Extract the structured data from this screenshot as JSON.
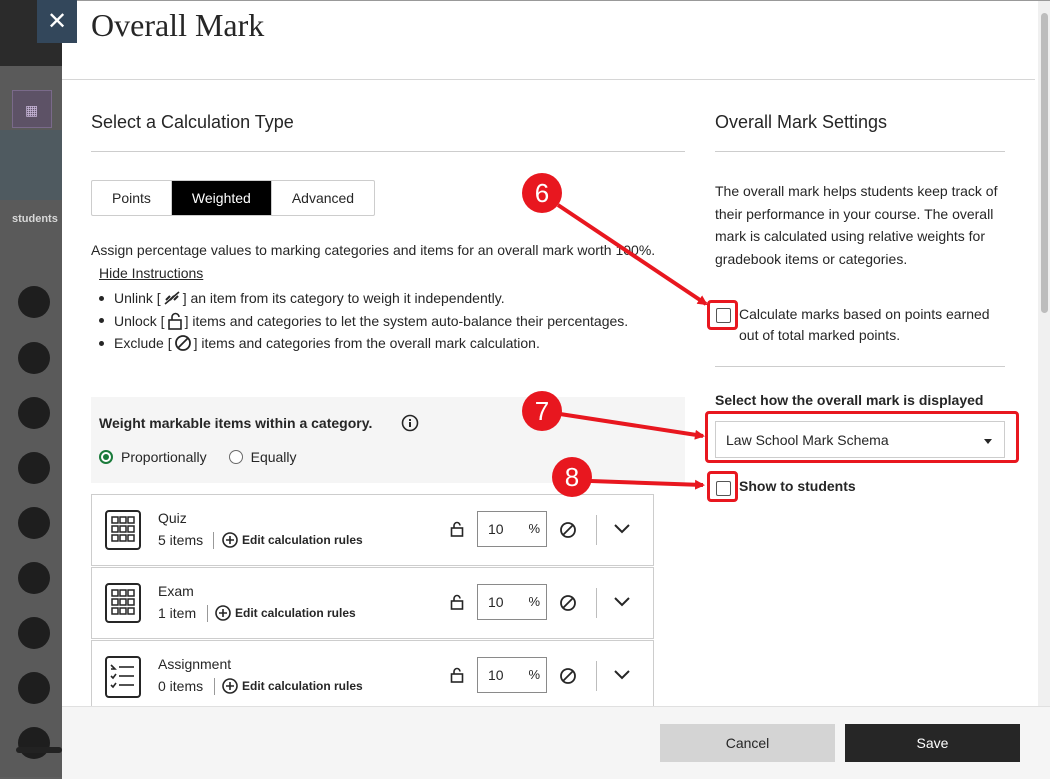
{
  "dialog": {
    "title": "Overall Mark",
    "close_glyph": "✕",
    "close_icon": "close-icon"
  },
  "calc": {
    "heading": "Select a Calculation Type",
    "tabs": [
      {
        "label": "Points",
        "active": false
      },
      {
        "label": "Weighted",
        "active": true
      },
      {
        "label": "Advanced",
        "active": false
      }
    ],
    "assign_text": "Assign percentage values to marking categories and items for an overall mark worth 100%.",
    "hide_instructions": "Hide Instructions",
    "bullets": {
      "unlink_pre": "Unlink [",
      "unlink_post": "] an item from its category to weigh it independently.",
      "unlock_pre": "Unlock [",
      "unlock_post": "] items and categories to let the system auto-balance their percentages.",
      "exclude_pre": "Exclude [",
      "exclude_post": "] items and categories from the overall mark calculation."
    },
    "weight_label": "Weight markable items within a category.",
    "radio_options": [
      {
        "label": "Proportionally",
        "selected": true
      },
      {
        "label": "Equally",
        "selected": false
      }
    ],
    "categories": [
      {
        "name": "Quiz",
        "count": "5 items",
        "rules_label": "Edit calculation rules",
        "percent": "10",
        "percent_sign": "%",
        "icon": "calculator-icon"
      },
      {
        "name": "Exam",
        "count": "1 item",
        "rules_label": "Edit calculation rules",
        "percent": "10",
        "percent_sign": "%",
        "icon": "calculator-icon"
      },
      {
        "name": "Assignment",
        "count": "0 items",
        "rules_label": "Edit calculation rules",
        "percent": "10",
        "percent_sign": "%",
        "icon": "checklist-icon"
      }
    ]
  },
  "settings": {
    "heading": "Overall Mark Settings",
    "description": "The overall mark helps students keep track of their performance in your course. The overall mark is calculated using relative weights for gradebook items or categories.",
    "calc_points_label": "Calculate marks based on points earned out of total marked points.",
    "calc_points_checked": false,
    "display_label": "Select how the overall mark is displayed",
    "display_value": "Law School Mark Schema",
    "show_students_label": "Show to students",
    "show_students_checked": false
  },
  "footer": {
    "cancel_label": "Cancel",
    "save_label": "Save"
  },
  "annotations": {
    "badges": [
      "6",
      "7",
      "8"
    ],
    "color": "#e8171f"
  },
  "colors": {
    "accent_green": "#1b7b3b",
    "active_tab": "#000000",
    "save_button": "#262626"
  }
}
